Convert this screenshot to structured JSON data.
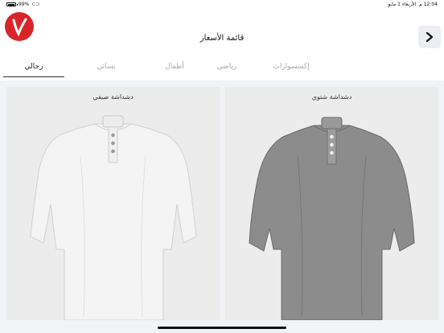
{
  "status_bar": {
    "battery": "99%",
    "time": "12:04 م",
    "date": "الأربعاء 1 مايو"
  },
  "header": {
    "title": "قائمة الأسعار"
  },
  "tabs": [
    {
      "label": "إكسسوارات",
      "active": false
    },
    {
      "label": "رياضي",
      "active": false
    },
    {
      "label": "أطفال",
      "active": false
    },
    {
      "label": "نسائي",
      "active": false
    },
    {
      "label": "رجالي",
      "active": true
    }
  ],
  "products": [
    {
      "label": "دشداشة شتوي",
      "color": "#8c8c8c"
    },
    {
      "label": "دشداشة صيفي",
      "color": "#f4f4f4"
    }
  ],
  "colors": {
    "brand": "#d9252a",
    "background": "#f1f3f6"
  },
  "icons": {
    "back": "chevron-right-icon",
    "logo": "brand-logo-icon"
  }
}
